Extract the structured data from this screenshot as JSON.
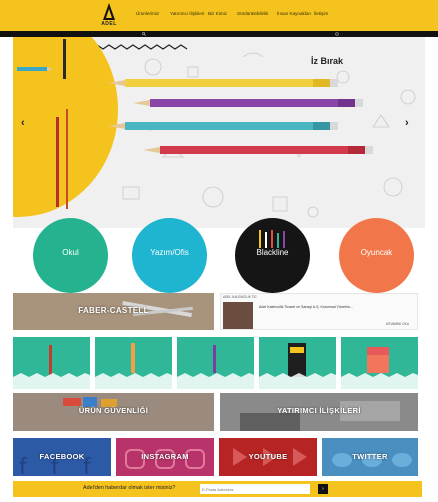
{
  "header": {
    "logo_text": "ADEL",
    "nav": [
      {
        "label": "Ürünlerimiz"
      },
      {
        "label": "Yatırımcı İlişkileri"
      },
      {
        "label": "Biz Kimiz"
      },
      {
        "label": "Sürdürülebilirlik"
      },
      {
        "label": "İnsan Kaynakları"
      },
      {
        "label": "İletişim"
      }
    ],
    "accent": "#f5c31e"
  },
  "hero": {
    "title": "İz Bırak",
    "prev_arrow": "‹",
    "next_arrow": "›"
  },
  "categories": [
    {
      "label": "Okul",
      "color": "#24b38e"
    },
    {
      "label": "Yazım/Ofis",
      "color": "#1fb4cf"
    },
    {
      "label": "Blackline",
      "color": "#151515"
    },
    {
      "label": "Oyuncak",
      "color": "#f1774a"
    }
  ],
  "promo": {
    "faber": "FABER-CASTELL",
    "safety": "ÜRÜN GÜVENLİĞİ",
    "investor": "YATIRIMCI İLİŞKİLERİ"
  },
  "news": {
    "head": "ADEL KALEMCİLİK TİC",
    "text": "Adel Kalemcilik Ticaret ve Sanayi A.Ş. Kurumsal Yönetim...",
    "more": "DEVAMINI OKU"
  },
  "social": [
    {
      "label": "FACEBOOK"
    },
    {
      "label": "INSTAGRAM"
    },
    {
      "label": "YOUTUBE"
    },
    {
      "label": "TWITTER"
    }
  ],
  "footer": {
    "text": "Adel'den haberdar olmak ister misiniz?",
    "placeholder": "E-Posta Adresiniz",
    "button": "›"
  }
}
